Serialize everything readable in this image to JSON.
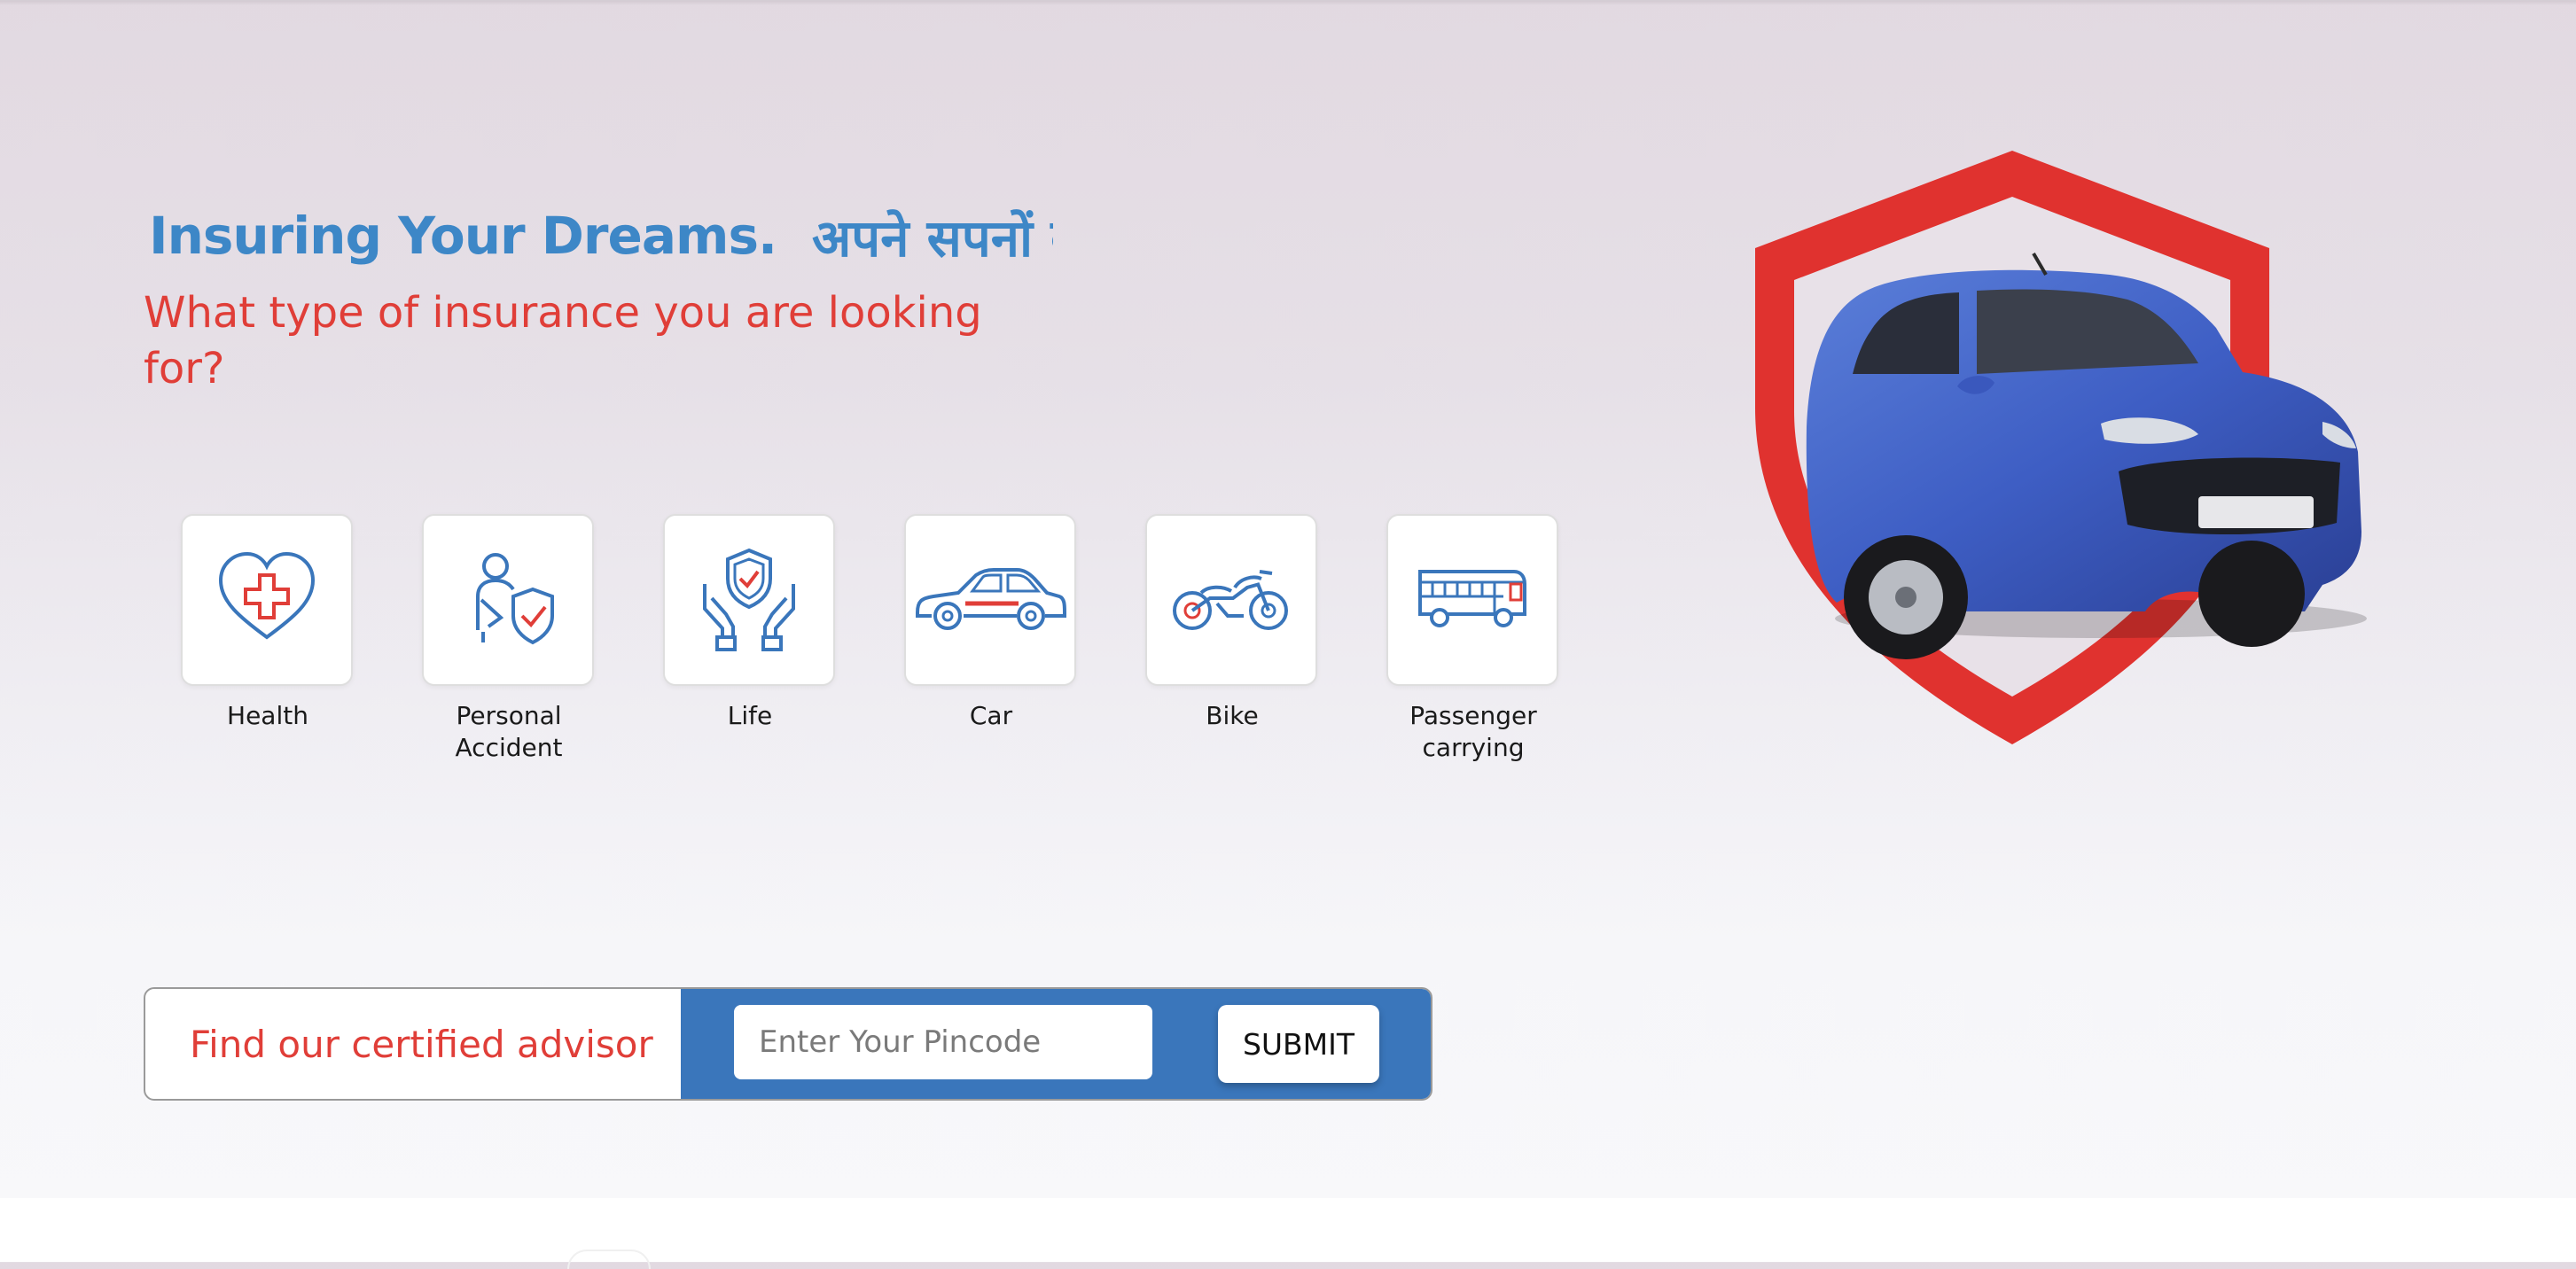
{
  "hero": {
    "headline_en": "Insuring Your Dreams.",
    "headline_hi": "अपने सपनों का बीमा",
    "subheading": "What type of insurance you are looking for?"
  },
  "categories": [
    {
      "label": "Health",
      "icon": "heart-cross-icon"
    },
    {
      "label": "Personal\nAccident",
      "icon": "person-shield-icon"
    },
    {
      "label": "Life",
      "icon": "hands-shield-icon"
    },
    {
      "label": "Car",
      "icon": "car-icon"
    },
    {
      "label": "Bike",
      "icon": "bike-icon"
    },
    {
      "label": "Passenger\ncarrying",
      "icon": "bus-icon"
    }
  ],
  "advisor": {
    "label": "Find our certified advisor",
    "pincode_placeholder": "Enter Your Pincode",
    "submit_label": "SUBMIT"
  },
  "colors": {
    "brand_blue": "#3a76bb",
    "headline_blue": "#3d87c7",
    "accent_red": "#e03e38"
  }
}
